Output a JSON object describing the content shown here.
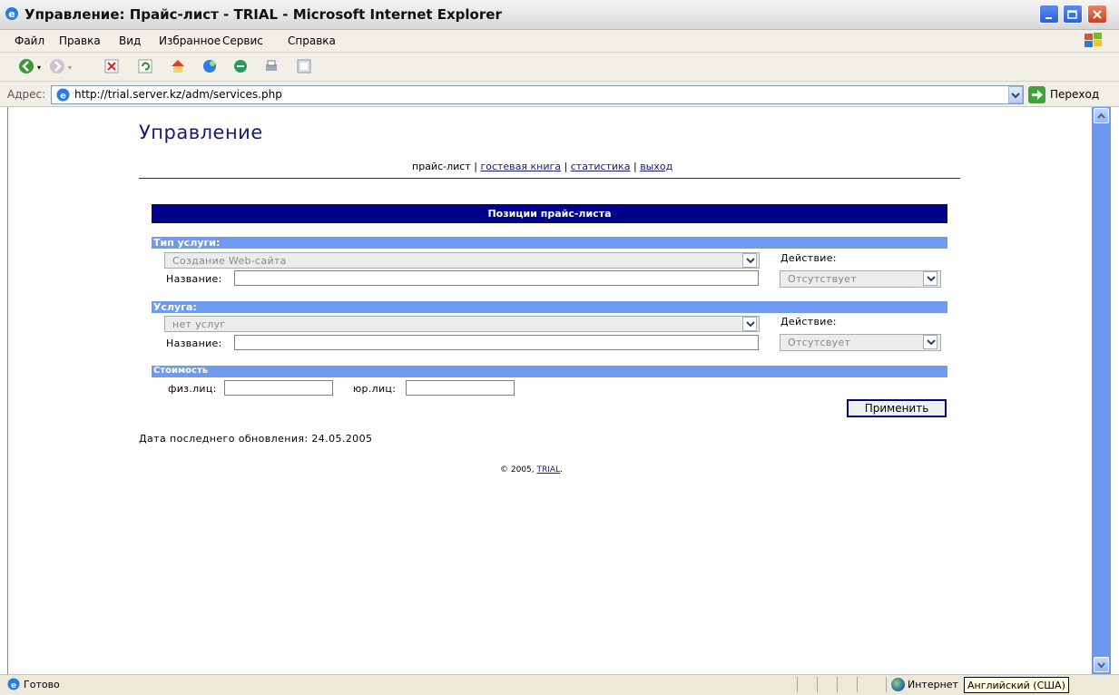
{
  "window": {
    "title": "Управление: Прайс-лист - TRIAL - Microsoft Internet Explorer"
  },
  "menu": [
    "Файл",
    "Правка",
    "Вид",
    "Избранное",
    "Сервис",
    "Справка"
  ],
  "toolbar": {
    "icons": [
      "back-icon",
      "forward-icon",
      "stop-icon",
      "refresh-icon",
      "home-icon",
      "search-icon",
      "favorites-icon",
      "print-icon",
      "edit-icon"
    ]
  },
  "address": {
    "label": "Адрес:",
    "url": "http://trial.server.kz/adm/services.php",
    "go_label": "Переход"
  },
  "page": {
    "title": "Управление",
    "nav": {
      "current": "прайс-лист",
      "links": [
        "гостевая книга",
        "статистика",
        "выход"
      ],
      "separator": "|"
    },
    "section_header": "Позиции прайс-листа",
    "service_type": {
      "label": "Тип услуги:",
      "selected": "Создание Web-сайта",
      "name_label": "Название:",
      "name_value": "",
      "action_label": "Действие:",
      "action_selected": "Отсутствует"
    },
    "service": {
      "label": "Услуга:",
      "selected": "нет услуг",
      "name_label": "Название:",
      "name_value": "",
      "action_label": "Действие:",
      "action_selected": "Отсутсвует"
    },
    "cost": {
      "label": "Стоимость",
      "individual_label": "физ.лиц:",
      "individual_value": "",
      "legal_label": "юр.лиц:",
      "legal_value": ""
    },
    "apply_button": "Применить",
    "last_updated": "Дата последнего обновления: 24.05.2005",
    "footer": {
      "copyright": "© 2005,",
      "link": "TRIAL",
      "suffix": "."
    }
  },
  "status": {
    "text": "Готово",
    "zone": "Интернет",
    "language_tooltip": "Английский (США)"
  },
  "colors": {
    "header_band": "#00008b",
    "section_bar": "#6e9bef",
    "link": "#1a1a6e",
    "scrollbar": "#6e97f2"
  }
}
